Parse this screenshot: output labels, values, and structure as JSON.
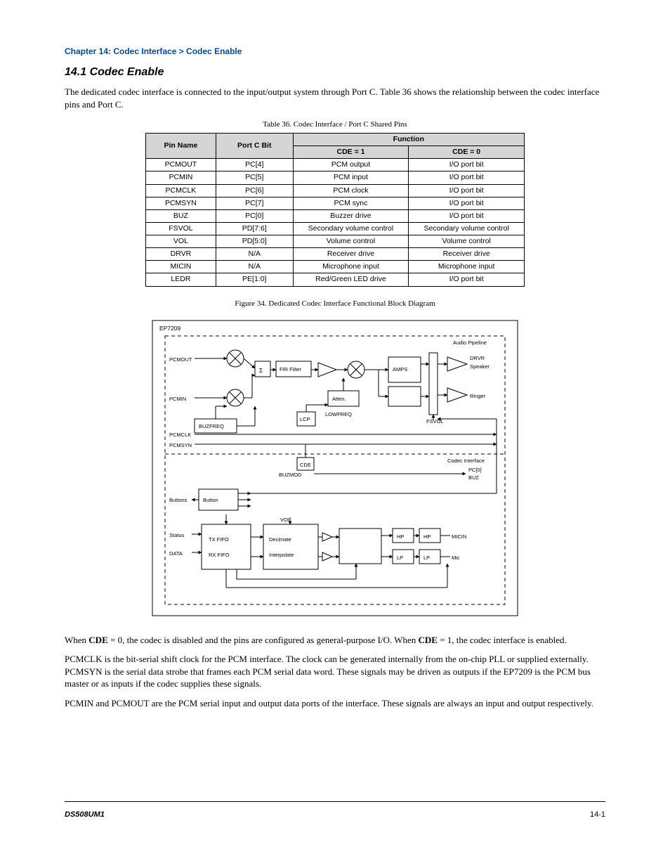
{
  "breadcrumb": "Chapter 14: Codec Interface > Codec Enable",
  "section_title": "14.1  Codec Enable",
  "lead": "The dedicated codec interface is connected to the input/output system through Port C. Table 36 shows the relationship between the codec interface pins and Port C.",
  "table_caption": "Table 36. Codec Interface / Port C Shared Pins",
  "table": {
    "head_pin": "Pin Name",
    "head_port": "Port C Bit",
    "head_group": "Function",
    "head_cde1": "CDE = 1",
    "head_cde0": "CDE = 0",
    "rows": [
      {
        "pin": "PCMOUT",
        "port": "PC[4]",
        "cde1": "PCM output",
        "cde0": "I/O port bit"
      },
      {
        "pin": "PCMIN",
        "port": "PC[5]",
        "cde1": "PCM input",
        "cde0": "I/O port bit"
      },
      {
        "pin": "PCMCLK",
        "port": "PC[6]",
        "cde1": "PCM clock",
        "cde0": "I/O port bit"
      },
      {
        "pin": "PCMSYN",
        "port": "PC[7]",
        "cde1": "PCM sync",
        "cde0": "I/O port bit"
      },
      {
        "pin": "BUZ",
        "port": "PC[0]",
        "cde1": "Buzzer drive",
        "cde0": "I/O port bit"
      },
      {
        "pin": "FSVOL",
        "port": "PD[7:6]",
        "cde1": "Secondary volume control",
        "cde0": "Secondary volume control"
      },
      {
        "pin": "VOL",
        "port": "PD[5:0]",
        "cde1": "Volume control",
        "cde0": "Volume control"
      },
      {
        "pin": "DRVR",
        "port": "N/A",
        "cde1": "Receiver drive",
        "cde0": "Receiver drive"
      },
      {
        "pin": "MICIN",
        "port": "N/A",
        "cde1": "Microphone input",
        "cde0": "Microphone input"
      },
      {
        "pin": "LEDR",
        "port": "PE[1:0]",
        "cde1": "Red/Green LED drive",
        "cde0": "I/O port bit"
      }
    ]
  },
  "fig_caption": "Figure 34. Dedicated Codec Interface Functional Block Diagram",
  "diagram": {
    "title_top": "EP7209",
    "region_audio": "Audio Pipeline",
    "region_codec": "Codec Interface",
    "blocks": {
      "sigma": "Σ",
      "buzfreq": "BUZFREQ",
      "fir": "FIR Filter",
      "attn": "Atten.",
      "lcp": "LCP",
      "amps": "AMPS",
      "cde": "CDE",
      "button": "Button",
      "txfifo": "TX FIFO",
      "rxfifo": "RX FIFO",
      "decimate": "Decimate",
      "interp": "Interpolate",
      "hp1": "HP",
      "lp1": "LP",
      "hp2": "HP",
      "lp2": "LP"
    },
    "labels": {
      "pcmout": "PCMOUT",
      "pcmin": "PCMIN",
      "pcmclk": "PCMCLK",
      "pcmsyn": "PCMSYN",
      "drvr": "DRVR",
      "fsvol": "FSVOL",
      "buz": "BUZ",
      "buz_gpio": "PC[0]",
      "vol": "VOL",
      "micin": "MICIN",
      "lowfreq": "LOWFREQ",
      "buzmod": "BUZMOD",
      "status": "Status",
      "data": "DATA",
      "speaker": "Speaker",
      "mic": "Mic",
      "ringer": "Ringer",
      "buttons": "Buttons"
    }
  },
  "body": {
    "p1a": "When ",
    "p1b": "CDE",
    "p1c": " = 0, the codec is disabled and the pins are configured as general-purpose I/O. When ",
    "p1d": "CDE",
    "p1e": " = 1, the codec interface is enabled.",
    "p2": "PCMCLK is the bit-serial shift clock for the PCM interface. The clock can be generated internally from the on-chip PLL or supplied externally. PCMSYN is the serial data strobe that frames each PCM serial data word. These signals may be driven as outputs if the EP7209 is the PCM bus master or as inputs if the codec supplies these signals.",
    "p3": "PCMIN and PCMOUT are the PCM serial input and output data ports of the interface. These signals are always an input and output respectively."
  },
  "footer": {
    "left": "DS508UM1",
    "right": "14-1"
  }
}
